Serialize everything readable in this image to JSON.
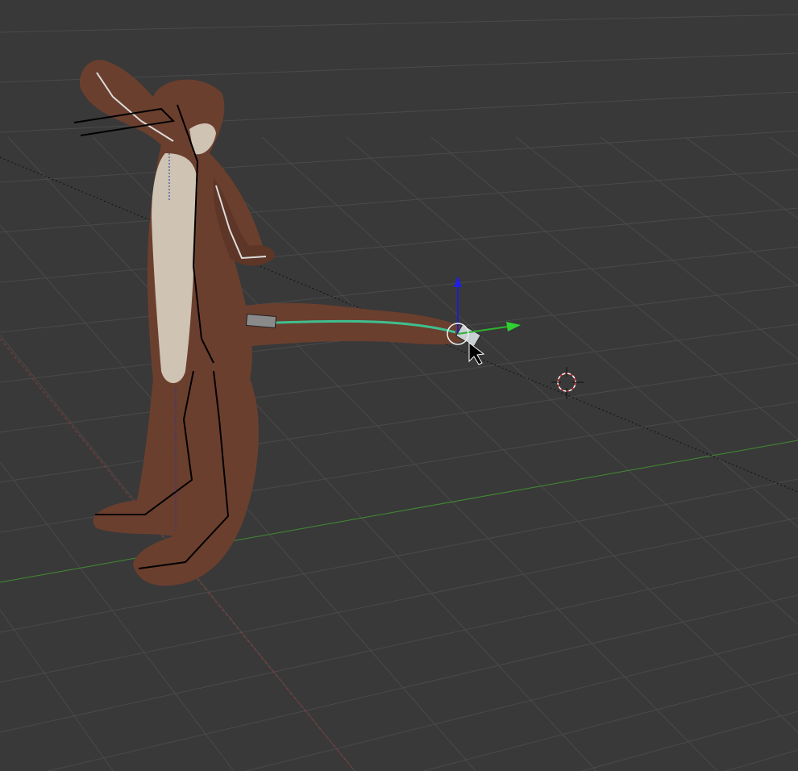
{
  "viewport": {
    "background_color": "#393939",
    "grid_color": "#4a4a4a",
    "x_axis_color": "#8a3a3a",
    "y_axis_color": "#3f8a2f",
    "fur_color": "#6b3f2e",
    "belly_color": "#cfc3b3",
    "selected_bone_color": "#3fbf8f"
  },
  "icons": [
    "3d-cursor-icon",
    "move-gizmo-icon",
    "mouse-cursor-icon"
  ]
}
